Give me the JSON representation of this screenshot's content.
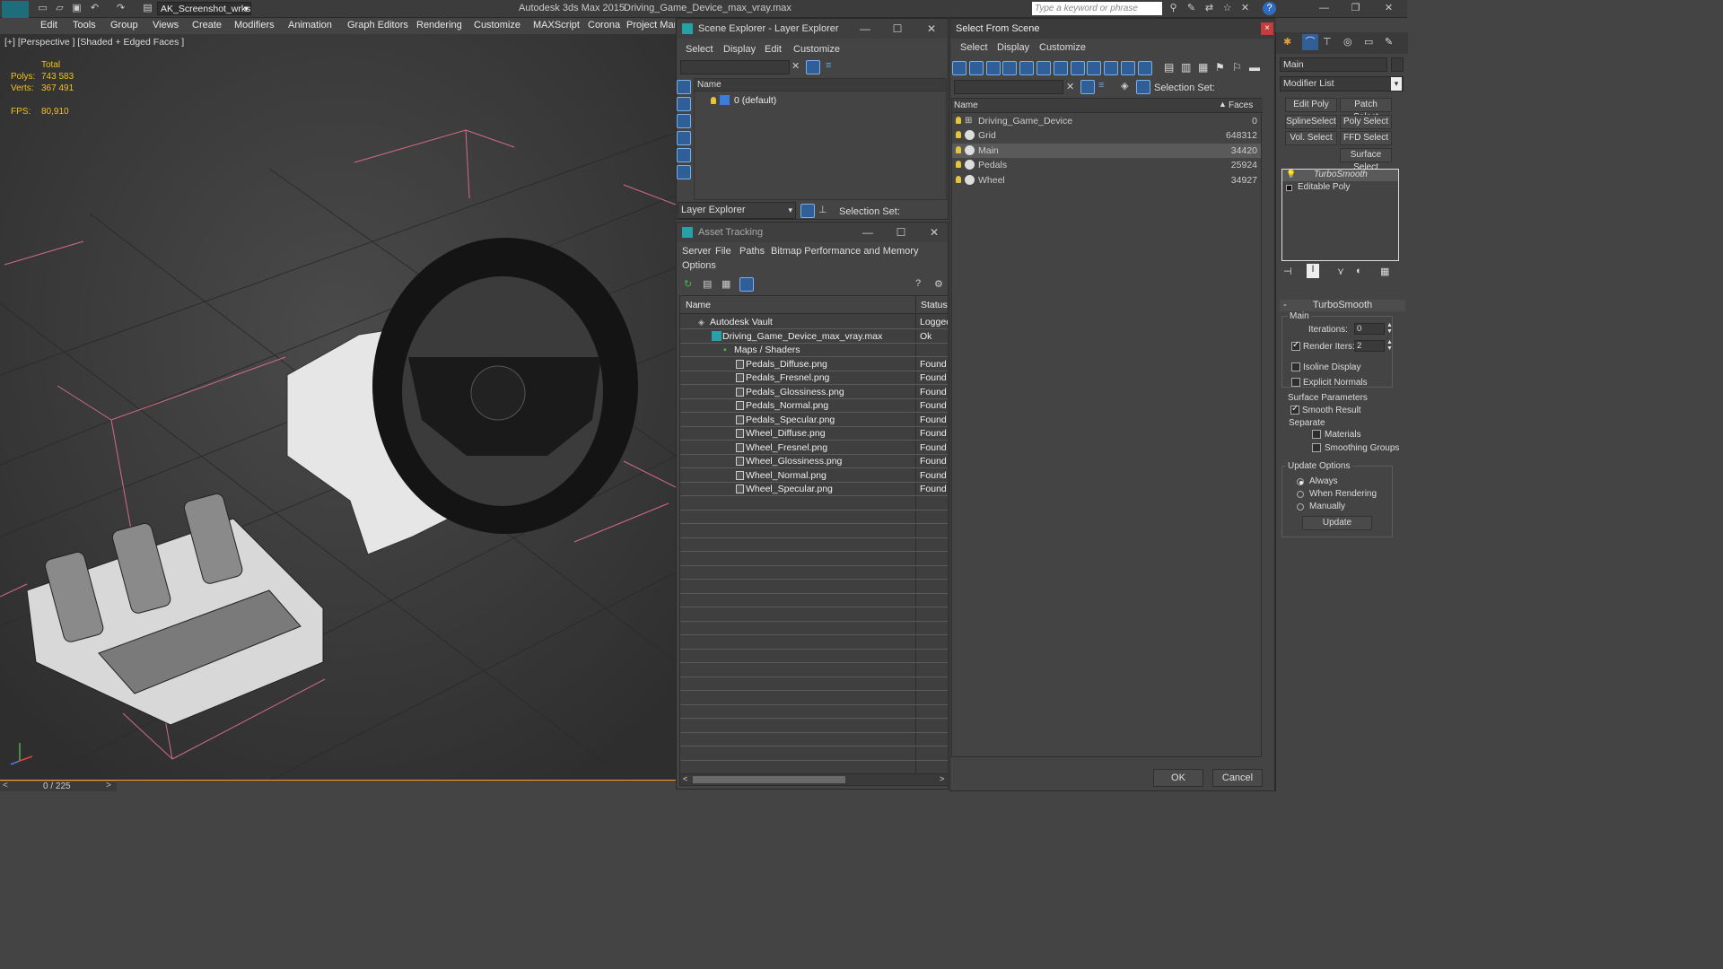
{
  "titlebar": {
    "workspace": "AK_Screenshot_wrksp",
    "app_title": "Autodesk 3ds Max  2015",
    "file_title": "Driving_Game_Device_max_vray.max",
    "search_placeholder": "Type a keyword or phrase"
  },
  "menubar": [
    "Edit",
    "Tools",
    "Group",
    "Views",
    "Create",
    "Modifiers",
    "Animation",
    "Graph Editors",
    "Rendering",
    "Customize",
    "MAXScript",
    "Corona",
    "Project Man"
  ],
  "viewport": {
    "label": "[+] [Perspective ] [Shaded + Edged Faces ]",
    "stats_total": "Total",
    "polys_label": "Polys:",
    "polys_value": "743 583",
    "verts_label": "Verts:",
    "verts_value": "367 491",
    "fps_label": "FPS:",
    "fps_value": "80,910"
  },
  "timeline": {
    "frame": "0 / 225"
  },
  "scene_explorer": {
    "title": "Scene Explorer - Layer Explorer",
    "menu": [
      "Select",
      "Display",
      "Edit",
      "Customize"
    ],
    "col_name": "Name",
    "layer": "0 (default)",
    "footer_label": "Layer Explorer",
    "selection_set": "Selection Set:"
  },
  "asset_tracking": {
    "title": "Asset Tracking",
    "menu": [
      "Server",
      "File",
      "Paths",
      "Bitmap Performance and Memory"
    ],
    "menu2": "Options",
    "col_name": "Name",
    "col_status": "Status",
    "rows": [
      {
        "name": "Autodesk Vault",
        "status": "Logged",
        "indent": 0
      },
      {
        "name": "Driving_Game_Device_max_vray.max",
        "status": "Ok",
        "indent": 1
      },
      {
        "name": "Maps / Shaders",
        "status": "",
        "indent": 2
      },
      {
        "name": "Pedals_Diffuse.png",
        "status": "Found",
        "indent": 3
      },
      {
        "name": "Pedals_Fresnel.png",
        "status": "Found",
        "indent": 3
      },
      {
        "name": "Pedals_Glossiness.png",
        "status": "Found",
        "indent": 3
      },
      {
        "name": "Pedals_Normal.png",
        "status": "Found",
        "indent": 3
      },
      {
        "name": "Pedals_Specular.png",
        "status": "Found",
        "indent": 3
      },
      {
        "name": "Wheel_Diffuse.png",
        "status": "Found",
        "indent": 3
      },
      {
        "name": "Wheel_Fresnel.png",
        "status": "Found",
        "indent": 3
      },
      {
        "name": "Wheel_Glossiness.png",
        "status": "Found",
        "indent": 3
      },
      {
        "name": "Wheel_Normal.png",
        "status": "Found",
        "indent": 3
      },
      {
        "name": "Wheel_Specular.png",
        "status": "Found",
        "indent": 3
      }
    ]
  },
  "select_from_scene": {
    "title": "Select From Scene",
    "menu": [
      "Select",
      "Display",
      "Customize"
    ],
    "selection_set": "Selection Set:",
    "col_name": "Name",
    "col_faces": "Faces",
    "rows": [
      {
        "name": "Driving_Game_Device",
        "faces": "0",
        "selected": false,
        "kind": "group"
      },
      {
        "name": "Grid",
        "faces": "648312",
        "selected": false,
        "kind": "mesh"
      },
      {
        "name": "Main",
        "faces": "34420",
        "selected": true,
        "kind": "mesh"
      },
      {
        "name": "Pedals",
        "faces": "25924",
        "selected": false,
        "kind": "mesh"
      },
      {
        "name": "Wheel",
        "faces": "34927",
        "selected": false,
        "kind": "mesh"
      }
    ],
    "ok": "OK",
    "cancel": "Cancel"
  },
  "command_panel": {
    "object_name": "Main",
    "modifier_list": "Modifier List",
    "buttons": [
      "Edit Poly",
      "Patch Select",
      "SplineSelect",
      "Poly Select",
      "Vol. Select",
      "FFD Select",
      "Surface Select"
    ],
    "stack": [
      "TurboSmooth",
      "Editable Poly"
    ],
    "rollout_title": "TurboSmooth",
    "main_group": "Main",
    "iterations_label": "Iterations:",
    "iterations_value": "0",
    "render_iters_label": "Render Iters:",
    "render_iters_value": "2",
    "isoline": "Isoline Display",
    "explicit": "Explicit Normals",
    "surface_params": "Surface Parameters",
    "smooth_result": "Smooth Result",
    "separate": "Separate",
    "materials": "Materials",
    "smoothing_groups": "Smoothing Groups",
    "update_options": "Update Options",
    "always": "Always",
    "when_rendering": "When Rendering",
    "manually": "Manually",
    "update_btn": "Update"
  }
}
